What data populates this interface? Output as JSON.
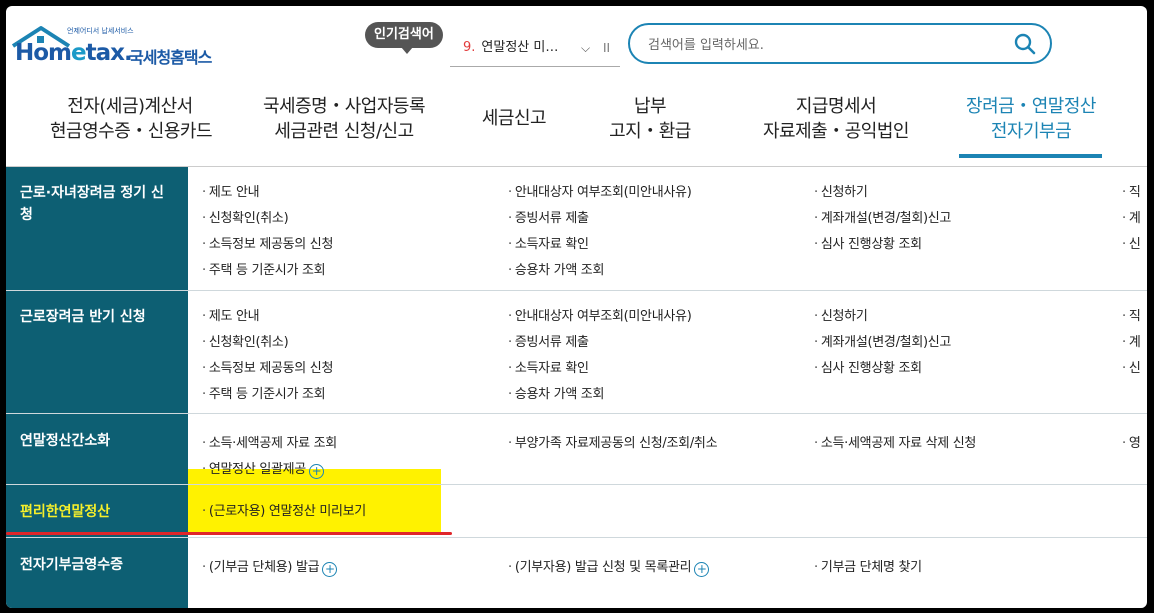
{
  "header": {
    "logo_small": "언제어디서 납세서비스",
    "logo_main_pre": "Hom",
    "logo_main_e": "e",
    "logo_main_post": "tax.",
    "logo_kr": "국세청홈택스",
    "popular_badge": "인기검색어",
    "ranking_num": "9.",
    "ranking_term": "연말정산 미…",
    "ranking_chevron": "⌵",
    "ranking_pause": "II",
    "search_placeholder": "검색어를 입력하세요."
  },
  "nav": [
    {
      "line1": "전자(세금)계산서",
      "line2": "현금영수증・신용카드"
    },
    {
      "line1": "국세증명・사업자등록",
      "line2": "세금관련 신청/신고"
    },
    {
      "line1": "세금신고",
      "line2": ""
    },
    {
      "line1": "납부",
      "line2": "고지・환급"
    },
    {
      "line1": "지급명세서",
      "line2": "자료제출・공익법인"
    },
    {
      "line1": "장려금・연말정산",
      "line2": "전자기부금"
    }
  ],
  "rows": [
    {
      "title": "근로·자녀장려금 정기 신청",
      "items": [
        "제도 안내",
        "신청확인(취소)",
        "소득정보 제공동의 신청",
        "주택 등 기준시가 조회",
        "안내대상자 여부조회(미안내사유)",
        "증빙서류 제출",
        "소득자료 확인",
        "승용차 가액 조회",
        "신청하기",
        "계좌개설(변경/철회)신고",
        "심사 진행상황 조회",
        "직",
        "계",
        "신"
      ]
    },
    {
      "title": "근로장려금 반기 신청",
      "items": [
        "제도 안내",
        "신청확인(취소)",
        "소득정보 제공동의 신청",
        "주택 등 기준시가 조회",
        "안내대상자 여부조회(미안내사유)",
        "증빙서류 제출",
        "소득자료 확인",
        "승용차 가액 조회",
        "신청하기",
        "계좌개설(변경/철회)신고",
        "심사 진행상황 조회",
        "직",
        "계",
        "신"
      ]
    },
    {
      "title": "연말정산간소화",
      "items": [
        "소득·세액공제 자료 조회",
        "연말정산 일괄제공",
        "부양가족 자료제공동의 신청/조회/취소",
        "소득·세액공제 자료 삭제 신청",
        "영"
      ]
    },
    {
      "title": "편리한연말정산",
      "items": [
        "(근로자용) 연말정산 미리보기"
      ]
    },
    {
      "title": "전자기부금영수증",
      "items": [
        "(기부금 단체용) 발급",
        "(기부자용) 발급 신청 및 목록관리",
        "기부금 단체명 찾기"
      ]
    }
  ],
  "plus_symbol": "+",
  "colors": {
    "brand_blue": "#1c84b4",
    "row_header": "#0d5f73",
    "highlight_yellow": "#fff200",
    "highlight_text": "#f5ef2b",
    "underline_red": "#e0262a",
    "ranking_num": "#e23b3b"
  }
}
